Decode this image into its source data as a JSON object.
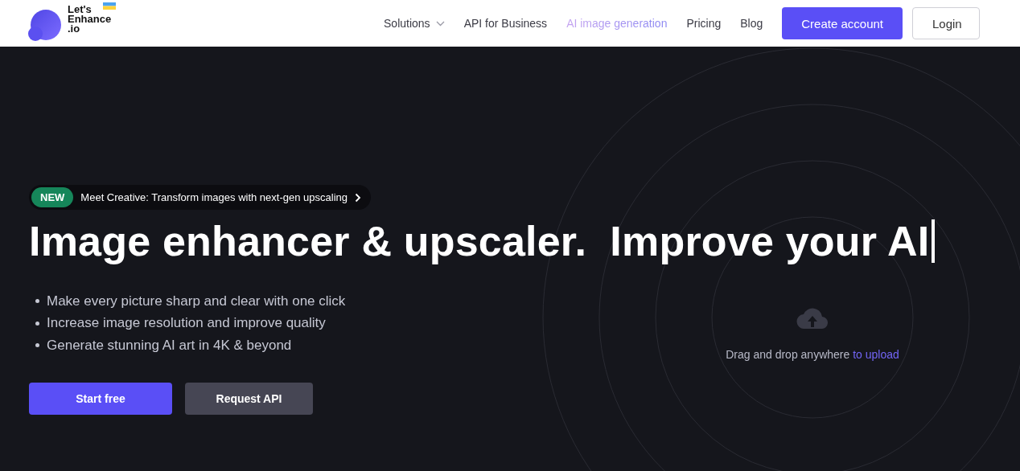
{
  "header": {
    "logo": {
      "lines": [
        "Let's",
        "Enhance",
        ".io"
      ]
    },
    "nav": [
      {
        "label": "Solutions",
        "has_dropdown": true,
        "highlighted": false
      },
      {
        "label": "API for Business",
        "has_dropdown": false,
        "highlighted": false
      },
      {
        "label": "AI image generation",
        "has_dropdown": false,
        "highlighted": true
      },
      {
        "label": "Pricing",
        "has_dropdown": false,
        "highlighted": false
      },
      {
        "label": "Blog",
        "has_dropdown": false,
        "highlighted": false
      }
    ],
    "buttons": [
      {
        "label": "Create account",
        "kind": "primary"
      },
      {
        "label": "Login",
        "kind": "outline"
      }
    ]
  },
  "hero": {
    "announcement": {
      "badge": "NEW",
      "text": "Meet Creative: Transform images with next-gen upscaling"
    },
    "headline": "Image enhancer & upscaler.  Improve your AI",
    "bullets": [
      "Make every picture sharp and clear with one click",
      "Increase image resolution and improve quality",
      "Generate stunning AI art in 4K & beyond"
    ],
    "buttons": [
      {
        "label": "Start free",
        "kind": "primary"
      },
      {
        "label": "Request API",
        "kind": "secondary"
      }
    ],
    "upload": {
      "text": "Drag and drop anywhere",
      "link": "to upload"
    }
  }
}
